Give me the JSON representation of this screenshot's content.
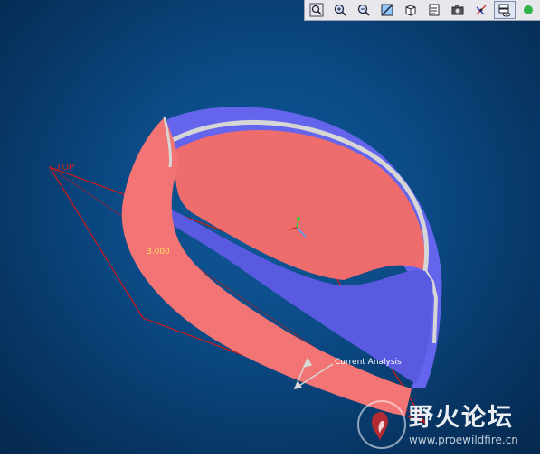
{
  "toolbar": {
    "buttons": [
      {
        "name": "zoom-fit-button",
        "icon": "magnifier-window-icon"
      },
      {
        "name": "zoom-in-button",
        "icon": "zoom-in-icon"
      },
      {
        "name": "zoom-out-button",
        "icon": "zoom-out-icon"
      },
      {
        "name": "repaint-button",
        "icon": "repaint-icon"
      },
      {
        "name": "saved-views-button",
        "icon": "cube-icon"
      },
      {
        "name": "view-manager-button",
        "icon": "clipboard-icon"
      },
      {
        "name": "screenshot-button",
        "icon": "camera-icon"
      },
      {
        "name": "datum-display-button",
        "icon": "datum-icon"
      },
      {
        "name": "layers-button",
        "icon": "eye-layers-icon"
      },
      {
        "name": "extra-button",
        "icon": "green-circle-icon"
      }
    ]
  },
  "viewport": {
    "datum_label": "TOP",
    "dimension_label": "3.000",
    "analysis_label": "Current Analysis",
    "colors": {
      "background": "#0b4a85",
      "outer_surface": "#f07070",
      "inner_surface": "#6a6af0",
      "edge": "#c8c8c8",
      "datum_plane": "#d01818"
    }
  },
  "watermark": {
    "title": "野火论坛",
    "url": "www.proewildfire.cn"
  }
}
